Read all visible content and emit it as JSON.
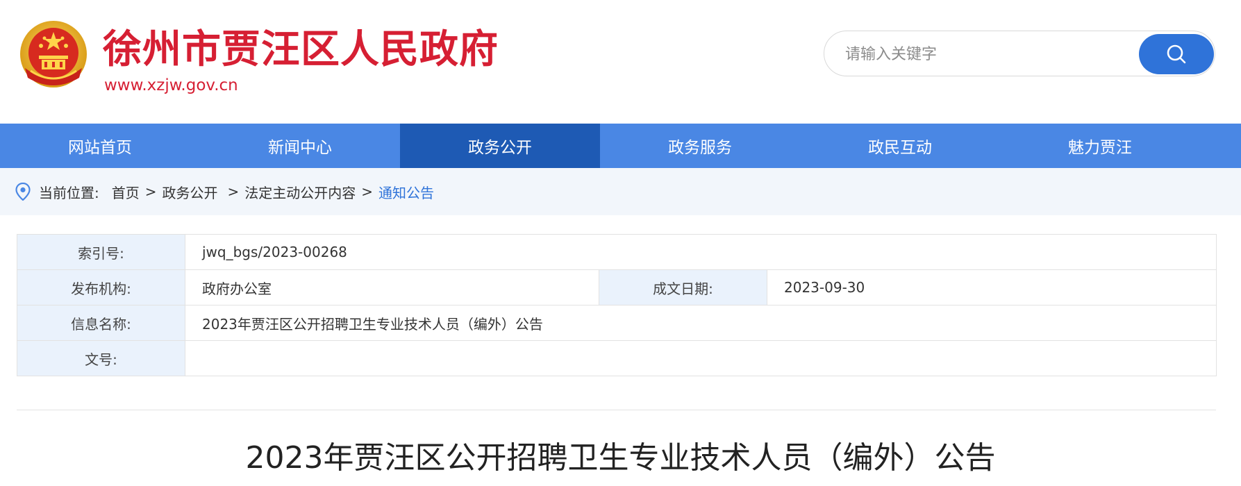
{
  "header": {
    "site_title": "徐州市贾汪区人民政府",
    "site_url": "www.xzjw.gov.cn",
    "emblem_icon": "national-emblem-icon",
    "brand_color": "#d61f33"
  },
  "search": {
    "placeholder": "请输入关键字",
    "value": "",
    "button_icon": "search-icon",
    "button_color": "#2f73d9"
  },
  "nav": {
    "items": [
      {
        "label": "网站首页"
      },
      {
        "label": "新闻中心"
      },
      {
        "label": "政务公开",
        "active": true
      },
      {
        "label": "政务服务"
      },
      {
        "label": "政民互动"
      },
      {
        "label": "魅力贾汪"
      }
    ],
    "color": "#4a87e4",
    "active_color": "#1e5ab4"
  },
  "breadcrumb": {
    "icon": "location-pin-icon",
    "prefix": "当前位置:",
    "items": [
      "首页",
      "政务公开",
      "法定主动公开内容",
      "通知公告"
    ],
    "separator": ">"
  },
  "info": {
    "index_label": "索引号:",
    "index_value": "jwq_bgs/2023-00268",
    "publisher_label": "发布机构:",
    "publisher_value": "政府办公室",
    "date_label": "成文日期:",
    "date_value": "2023-09-30",
    "name_label": "信息名称:",
    "name_value": "2023年贾汪区公开招聘卫生专业技术人员（编外）公告",
    "docno_label": "文号:",
    "docno_value": ""
  },
  "article": {
    "title": "2023年贾汪区公开招聘卫生专业技术人员（编外）公告"
  }
}
